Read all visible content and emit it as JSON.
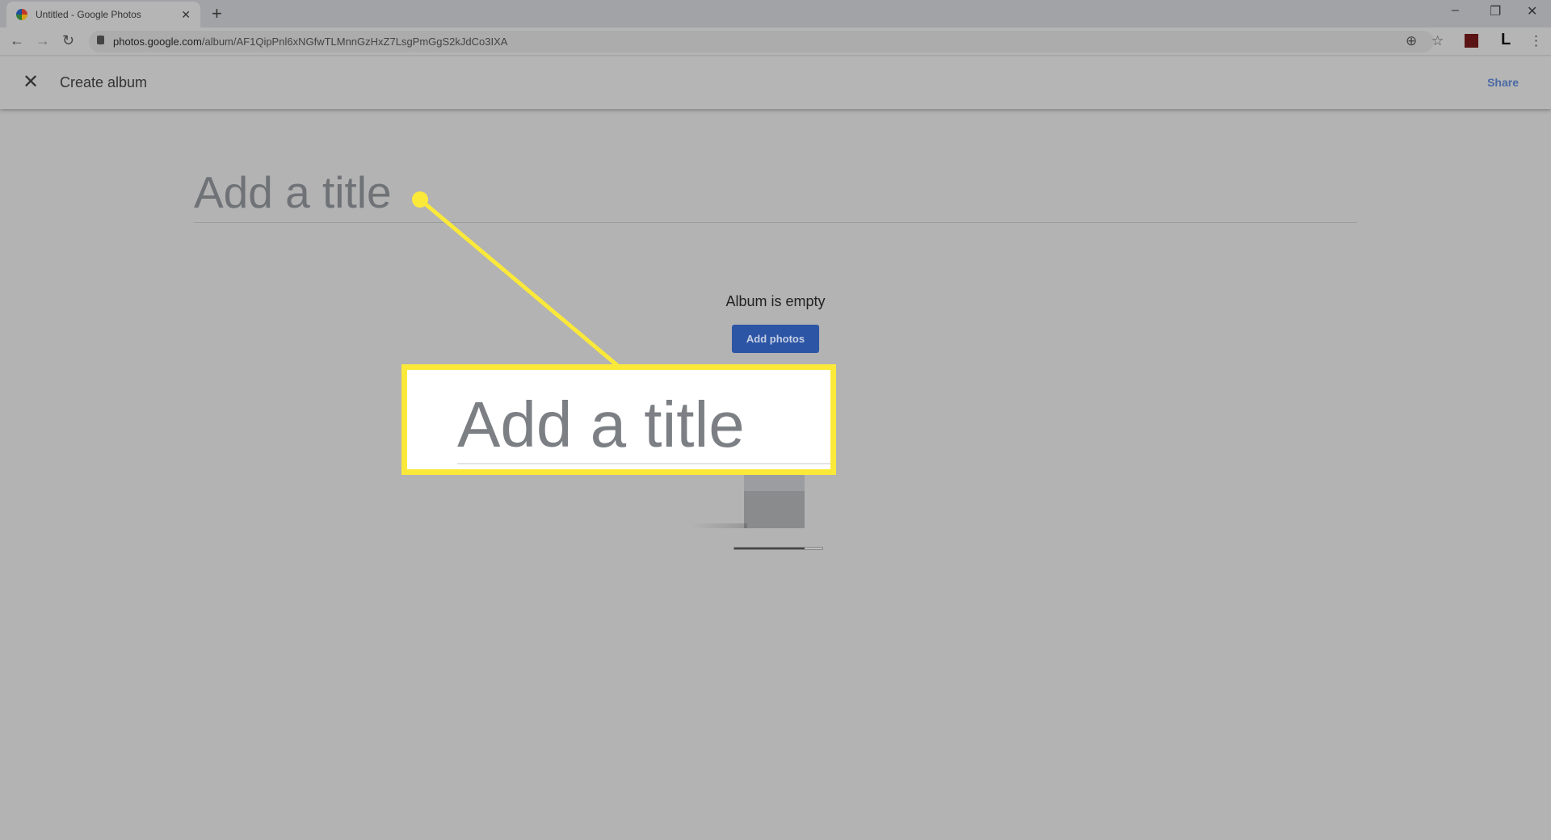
{
  "browser": {
    "tab_title": "Untitled - Google Photos",
    "url_host": "photos.google.com",
    "url_path": "/album/AF1QipPnl6xNGfwTLMnnGzHxZ7LsgPmGgS2kJdCo3IXA"
  },
  "header": {
    "title": "Create album",
    "share_label": "Share"
  },
  "album": {
    "title_placeholder": "Add a title",
    "empty_text": "Album is empty",
    "add_photos_label": "Add photos",
    "progress": 0.8
  },
  "callout": {
    "text": "Add a title",
    "color": "#fbe93a"
  },
  "colors": {
    "accent": "#2d55a6",
    "share": "#4a6aa5"
  }
}
